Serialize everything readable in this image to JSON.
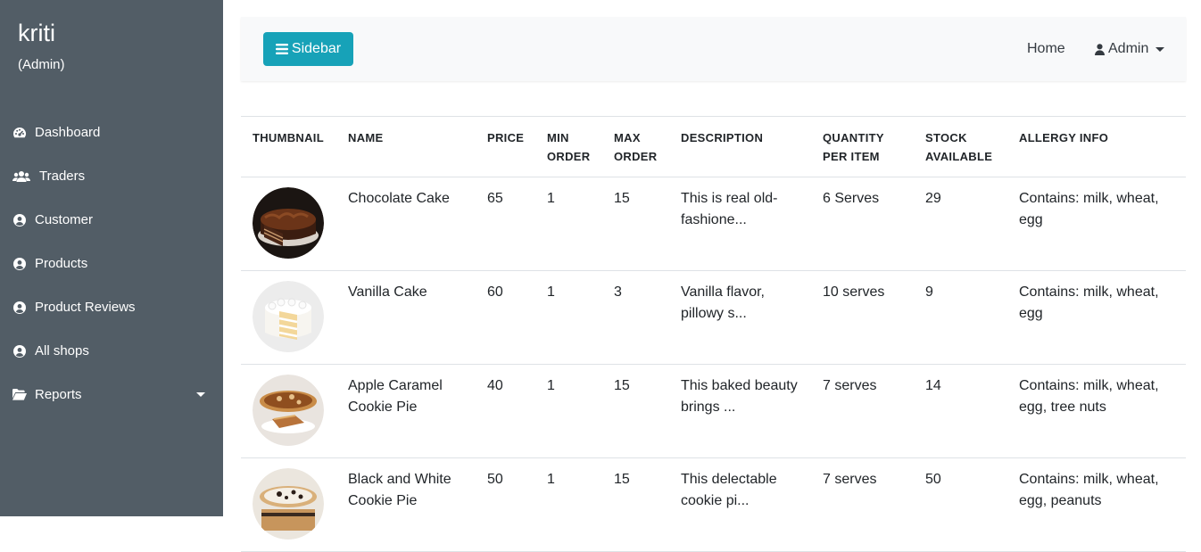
{
  "sidebar": {
    "brand": "kriti",
    "role": "(Admin)",
    "items": [
      {
        "label": "Dashboard",
        "icon": "tachometer-icon"
      },
      {
        "label": "Traders",
        "icon": "users-icon"
      },
      {
        "label": "Customer",
        "icon": "user-circle-icon"
      },
      {
        "label": "Products",
        "icon": "user-circle-icon"
      },
      {
        "label": "Product Reviews",
        "icon": "user-circle-icon"
      },
      {
        "label": "All shops",
        "icon": "user-circle-icon"
      },
      {
        "label": "Reports",
        "icon": "folder-open-icon",
        "has_dropdown": true
      }
    ]
  },
  "topbar": {
    "toggle_label": "Sidebar",
    "home_label": "Home",
    "admin_label": "Admin"
  },
  "table": {
    "headers": [
      "THUMBNAIL",
      "NAME",
      "PRICE",
      "MIN ORDER",
      "MAX ORDER",
      "DESCRIPTION",
      "QUANTITY PER ITEM",
      "STOCK AVAILABLE",
      "ALLERGY INFO"
    ],
    "rows": [
      {
        "thumbnail": "chocolate-cake",
        "name": "Chocolate Cake",
        "price": "65",
        "min_order": "1",
        "max_order": "15",
        "description": "This is real old-fashione...",
        "quantity": "6 Serves",
        "stock": "29",
        "allergy": "Contains: milk, wheat, egg"
      },
      {
        "thumbnail": "vanilla-cake",
        "name": "Vanilla Cake",
        "price": "60",
        "min_order": "1",
        "max_order": "3",
        "description": "Vanilla flavor, pillowy s...",
        "quantity": "10 serves",
        "stock": "9",
        "allergy": "Contains: milk, wheat, egg"
      },
      {
        "thumbnail": "apple-caramel-pie",
        "name": "Apple Caramel Cookie Pie",
        "price": "40",
        "min_order": "1",
        "max_order": "15",
        "description": "This baked beauty brings ...",
        "quantity": "7 serves",
        "stock": "14",
        "allergy": "Contains: milk, wheat, egg, tree nuts"
      },
      {
        "thumbnail": "black-white-pie",
        "name": "Black and White Cookie Pie",
        "price": "50",
        "min_order": "1",
        "max_order": "15",
        "description": "This delectable cookie pi...",
        "quantity": "7 serves",
        "stock": "50",
        "allergy": "Contains: milk, wheat, egg, peanuts"
      }
    ]
  },
  "colors": {
    "sidebar_bg": "#525d66",
    "accent": "#17a2b8",
    "topbar_bg": "#f8f9fa"
  }
}
